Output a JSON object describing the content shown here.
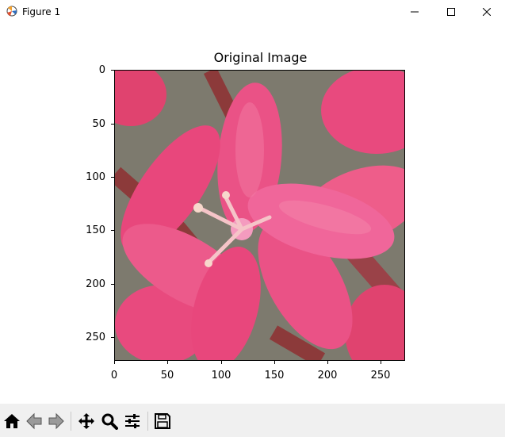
{
  "window": {
    "title": "Figure 1"
  },
  "axes": {
    "title": "Original Image",
    "x_ticks": [
      "0",
      "50",
      "100",
      "150",
      "200",
      "250"
    ],
    "y_ticks": [
      "0",
      "50",
      "100",
      "150",
      "200",
      "250"
    ]
  },
  "image": {
    "description_icon": "flower-image",
    "colors": {
      "petal": "#e84a7e",
      "petal_light": "#f27aa1",
      "stem": "#8c3a3a",
      "background": "#6f7a6a"
    }
  },
  "toolbar": {
    "buttons": [
      "home-icon",
      "back-icon",
      "forward-icon",
      "pan-icon",
      "zoom-icon",
      "configure-icon",
      "save-icon"
    ]
  }
}
